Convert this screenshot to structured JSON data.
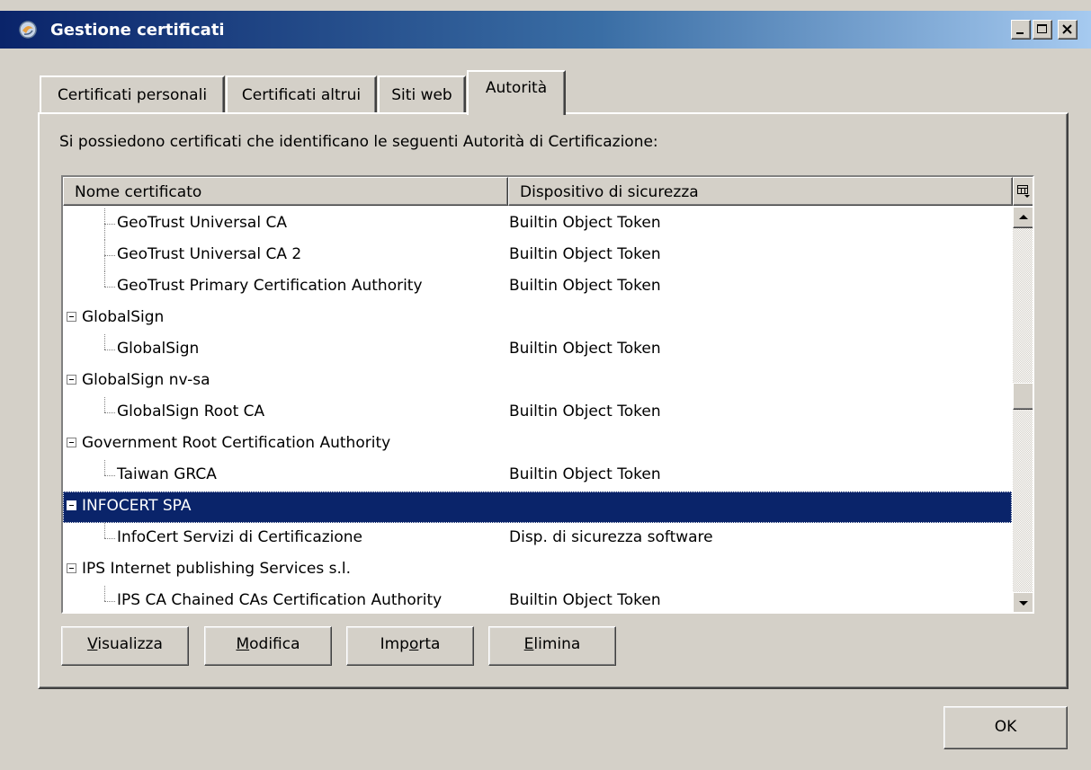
{
  "window": {
    "title": "Gestione certificati",
    "controls": [
      "minimize-icon",
      "maximize-icon",
      "close-icon"
    ]
  },
  "tabs": [
    {
      "label": "Certificati personali",
      "active": false
    },
    {
      "label": "Certificati altrui",
      "active": false
    },
    {
      "label": "Siti web",
      "active": false
    },
    {
      "label": "Autorità",
      "active": true
    }
  ],
  "intro_text": "Si possiedono certificati che identificano le seguenti Autorità di Certificazione:",
  "table": {
    "columns": [
      "Nome certificato",
      "Dispositivo di sicurezza"
    ],
    "picker_icon": "column-picker-icon",
    "rows": [
      {
        "type": "child",
        "name": "GeoTrust Universal CA",
        "device": "Builtin Object Token"
      },
      {
        "type": "child",
        "name": "GeoTrust Universal CA 2",
        "device": "Builtin Object Token"
      },
      {
        "type": "child",
        "name": "GeoTrust Primary Certification Authority",
        "device": "Builtin Object Token"
      },
      {
        "type": "group",
        "name": "GlobalSign",
        "device": ""
      },
      {
        "type": "child",
        "name": "GlobalSign",
        "device": "Builtin Object Token"
      },
      {
        "type": "group",
        "name": "GlobalSign nv-sa",
        "device": ""
      },
      {
        "type": "child",
        "name": "GlobalSign Root CA",
        "device": "Builtin Object Token"
      },
      {
        "type": "group",
        "name": "Government Root Certification Authority",
        "device": ""
      },
      {
        "type": "child",
        "name": "Taiwan GRCA",
        "device": "Builtin Object Token"
      },
      {
        "type": "group",
        "name": "INFOCERT SPA",
        "device": "",
        "selected": true
      },
      {
        "type": "child",
        "name": "InfoCert Servizi di Certificazione",
        "device": "Disp. di sicurezza software"
      },
      {
        "type": "group",
        "name": "IPS Internet publishing Services s.l.",
        "device": ""
      },
      {
        "type": "child",
        "name": "IPS CA Chained CAs Certification Authority",
        "device": "Builtin Object Token"
      }
    ]
  },
  "buttons": {
    "view": {
      "label": "Visualizza",
      "mnemonic": "V"
    },
    "edit": {
      "label": "Modifica",
      "mnemonic": "M"
    },
    "import": {
      "label": "Importa",
      "mnemonic": "o"
    },
    "delete": {
      "label": "Elimina",
      "mnemonic": "E"
    },
    "ok": {
      "label": "OK"
    }
  },
  "colors": {
    "title_gradient_start": "#0a246a",
    "title_gradient_end": "#a6caf0",
    "selection": "#0a246a",
    "face": "#d4d0c8"
  }
}
